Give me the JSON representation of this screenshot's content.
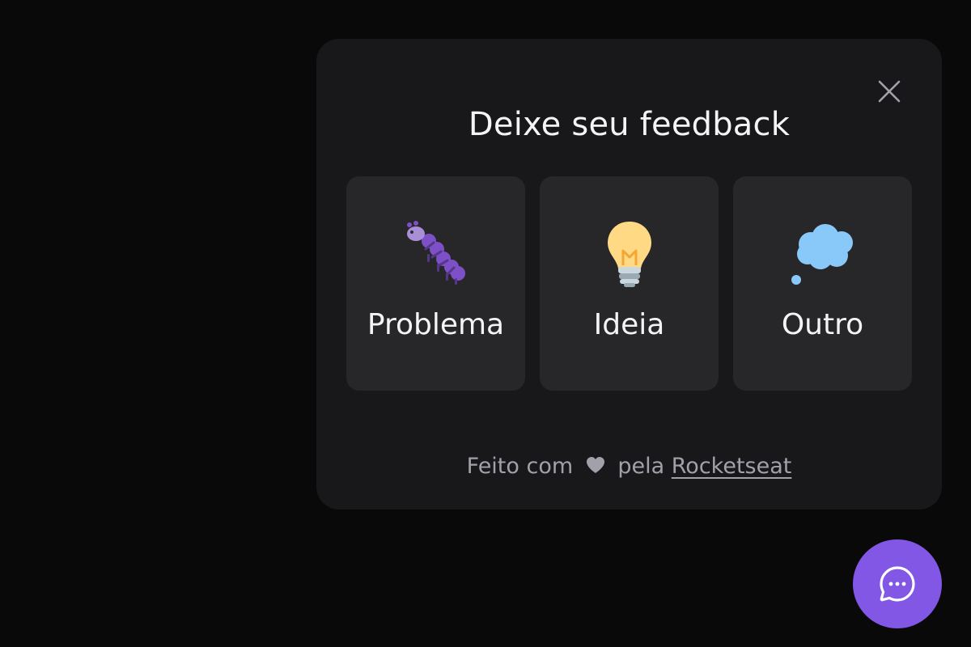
{
  "popup": {
    "title": "Deixe seu feedback",
    "close_icon": "close-icon"
  },
  "options": [
    {
      "label": "Problema",
      "icon": "bug-icon"
    },
    {
      "label": "Ideia",
      "icon": "lightbulb-icon"
    },
    {
      "label": "Outro",
      "icon": "thought-balloon-icon"
    }
  ],
  "footer": {
    "prefix": "Feito com",
    "middle": "pela",
    "link": "Rocketseat",
    "heart_icon": "heart-icon"
  },
  "fab": {
    "icon": "chat-bubble-icon"
  },
  "colors": {
    "background": "#09090a",
    "popup": "#18181b",
    "card": "#27272a",
    "text": "#f4f4f5",
    "muted": "#a1a1aa",
    "brand": "#8257e5"
  }
}
